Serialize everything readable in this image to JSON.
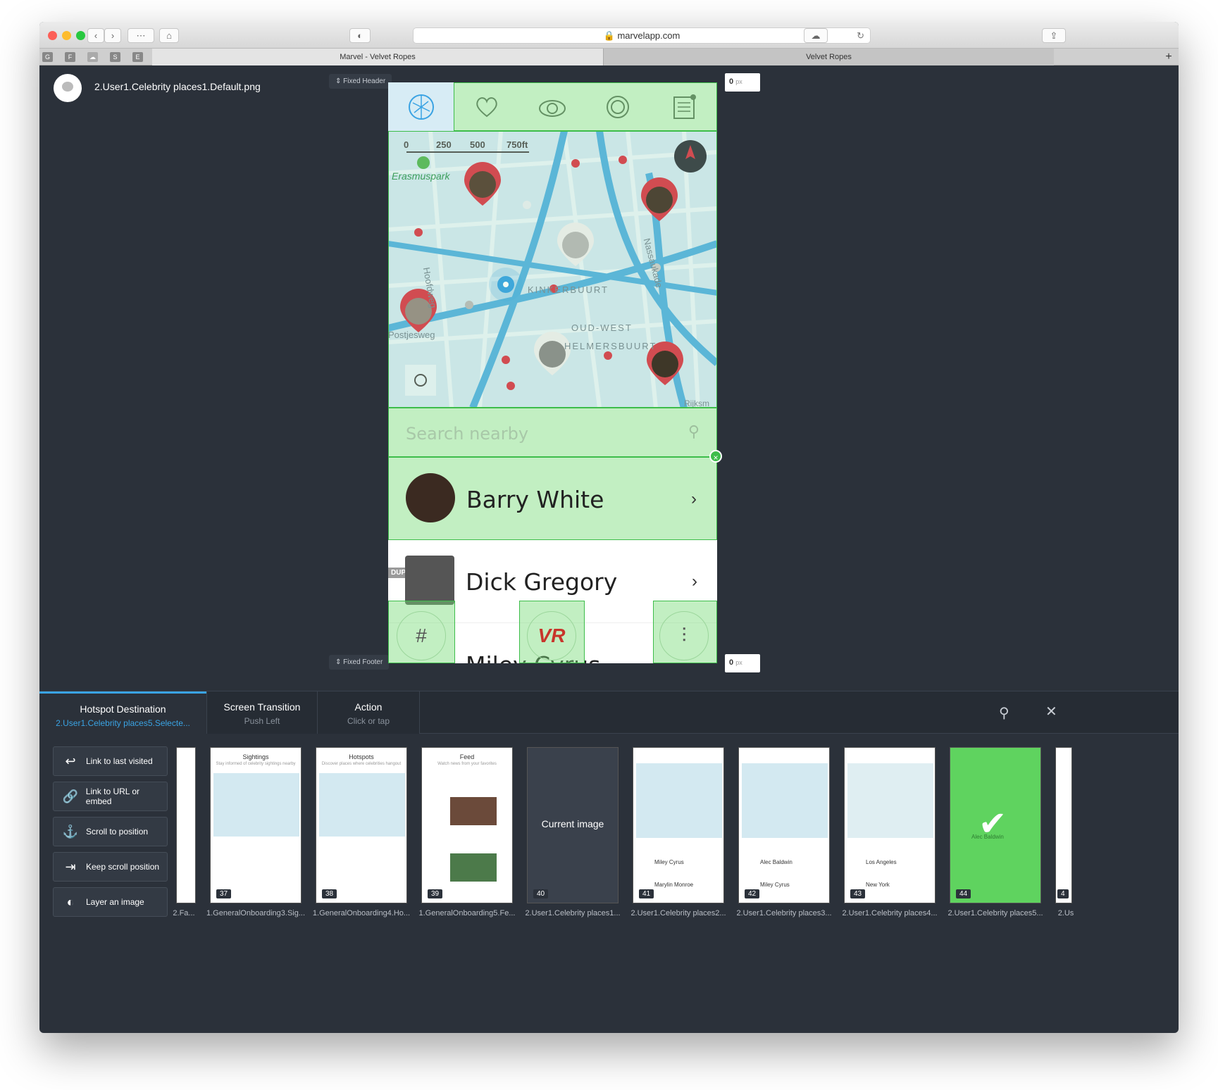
{
  "browser": {
    "url": "marvelapp.com",
    "tabs": [
      {
        "label": "Marvel - Velvet Ropes"
      },
      {
        "label": "Velvet Ropes"
      }
    ],
    "favicons": [
      "G",
      "F",
      "S",
      "E"
    ]
  },
  "editor": {
    "filename": "2.User1.Celebrity places1.Default.png",
    "fixed_header_label": "Fixed Header",
    "fixed_footer_label": "Fixed Footer",
    "px_top": "0",
    "px_bottom": "0",
    "px_unit": "px"
  },
  "phone": {
    "map": {
      "scale_labels": [
        "0",
        "250",
        "500",
        "750ft"
      ],
      "place_labels": [
        "Erasmuspark",
        "KINKERBUURT",
        "OUD-WEST",
        "HELMERSBUURT",
        "Nassaukade",
        "Hoofdweg",
        "Postjesweg",
        "Rijksm"
      ]
    },
    "search_placeholder": "Search nearby",
    "rows": [
      {
        "name": "Barry White"
      },
      {
        "name": "Dick Gregory"
      },
      {
        "name": "Miley Cyrus"
      }
    ],
    "duplicate_label": "DUPLICATE",
    "vr_logo": "VR"
  },
  "panel": {
    "tabs": [
      {
        "title": "Hotspot Destination",
        "sub": "2.User1.Celebrity places5.Selecte..."
      },
      {
        "title": "Screen Transition",
        "sub": "Push Left"
      },
      {
        "title": "Action",
        "sub": "Click or tap"
      }
    ],
    "side_buttons": [
      {
        "label": "Link to last visited",
        "icon": "reply-icon"
      },
      {
        "label": "Link to URL or embed",
        "icon": "link-icon"
      },
      {
        "label": "Scroll to position",
        "icon": "anchor-icon"
      },
      {
        "label": "Keep scroll position",
        "icon": "scroll-lock-icon"
      },
      {
        "label": "Layer an image",
        "icon": "toggle-icon"
      }
    ],
    "thumbnails": [
      {
        "label": "2.Fa...",
        "num": ""
      },
      {
        "label": "1.GeneralOnboarding3.Sig...",
        "num": "37",
        "title": "Sightings",
        "subtitle": "Stay informed of celebrity sightings nearby"
      },
      {
        "label": "1.GeneralOnboarding4.Ho...",
        "num": "38",
        "title": "Hotspots",
        "subtitle": "Discover places where celebrities hangout"
      },
      {
        "label": "1.GeneralOnboarding5.Fe...",
        "num": "39",
        "title": "Feed",
        "subtitle": "Watch news from your favorites"
      },
      {
        "label": "2.User1.Celebrity places1...",
        "num": "40",
        "current": "Current image"
      },
      {
        "label": "2.User1.Celebrity places2...",
        "num": "41",
        "names": [
          "Miley Cyrus",
          "Marylin Monroe"
        ]
      },
      {
        "label": "2.User1.Celebrity places3...",
        "num": "42",
        "names": [
          "Alec Baldwin",
          "Miley Cyrus"
        ]
      },
      {
        "label": "2.User1.Celebrity places4...",
        "num": "43",
        "names": [
          "Los Angeles",
          "New York"
        ]
      },
      {
        "label": "2.User1.Celebrity places5...",
        "num": "44",
        "names": [
          "Alec Baldwin"
        ]
      },
      {
        "label": "2.Us",
        "num": "4"
      }
    ]
  },
  "colors": {
    "editor_bg": "#2b313a",
    "hotspot_green": "#3dbd4a",
    "accent_blue": "#3aa3e3",
    "pin_red": "#d9414f",
    "vr_red": "#c8352b"
  }
}
